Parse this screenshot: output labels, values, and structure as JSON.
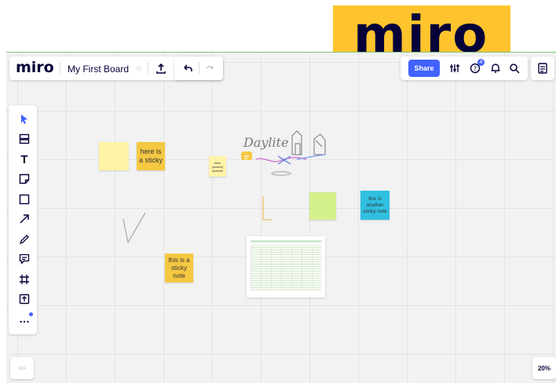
{
  "logo_banner": {
    "text": "miro",
    "color": "#ffc42d"
  },
  "toolbar": {
    "brand": "miro",
    "board_title": "My First Board",
    "icons": [
      "star-icon",
      "upload-icon",
      "undo-icon",
      "redo-icon"
    ]
  },
  "top_right": {
    "share_label": "Share",
    "notification_count": "4",
    "icons": [
      "settings-sliders-icon",
      "help-icon",
      "bell-icon",
      "search-icon",
      "notes-icon"
    ]
  },
  "left_toolbar": {
    "tools": [
      "select-icon",
      "templates-icon",
      "text-icon",
      "sticky-note-icon",
      "shape-icon",
      "arrow-icon",
      "pen-icon",
      "comment-icon",
      "frame-icon",
      "upload-icon",
      "more-icon"
    ]
  },
  "stickies": [
    {
      "text": "",
      "color": "#fff3a8"
    },
    {
      "text": "here is a sticky",
      "color": "#f5c842"
    },
    {
      "text": "hello (sketch) scribble",
      "color": "#fff3a8"
    },
    {
      "text": "",
      "color": "#d4f08a"
    },
    {
      "text": "this is another sticky note",
      "color": "#2fc0e0"
    },
    {
      "text": "this is a sticky note",
      "color": "#f5c842"
    }
  ],
  "sketch_text": "Daylite",
  "bottom": {
    "expand_label": ">>",
    "zoom": "20%"
  },
  "colors": {
    "accent": "#4262ff",
    "brand_text": "#050038",
    "canvas": "#f2f2f2"
  }
}
